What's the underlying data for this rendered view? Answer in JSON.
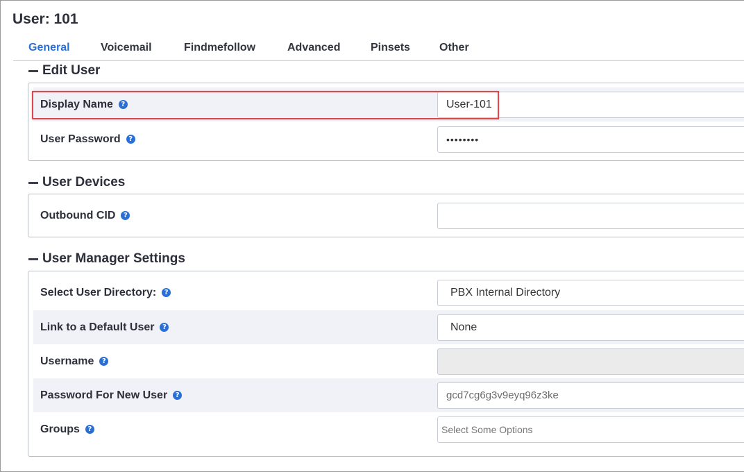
{
  "page": {
    "title": "User: 101"
  },
  "tabs": [
    {
      "label": "General",
      "active": true
    },
    {
      "label": "Voicemail"
    },
    {
      "label": "Findmefollow"
    },
    {
      "label": "Advanced"
    },
    {
      "label": "Pinsets"
    },
    {
      "label": "Other"
    }
  ],
  "sections": {
    "edit_user": {
      "title": "Edit User",
      "display_name": {
        "label": "Display Name",
        "value": "User-101"
      },
      "user_password": {
        "label": "User Password",
        "value": "••••••••"
      }
    },
    "user_devices": {
      "title": "User Devices",
      "outbound_cid": {
        "label": "Outbound CID",
        "value": ""
      }
    },
    "user_manager": {
      "title": "User Manager Settings",
      "directory": {
        "label": "Select User Directory:",
        "value": "PBX Internal Directory"
      },
      "default_user": {
        "label": "Link to a Default User",
        "value": "None"
      },
      "username": {
        "label": "Username",
        "value": ""
      },
      "new_password": {
        "label": "Password For New User",
        "value": "gcd7cg6g3v9eyq96z3ke"
      },
      "groups": {
        "label": "Groups",
        "placeholder": "Select Some Options"
      }
    }
  },
  "icons": {
    "help": "?",
    "collapse": "minus-icon"
  },
  "colors": {
    "accent": "#2a6fd6",
    "highlight": "#e0474c",
    "row_shade": "#f0f2f7"
  }
}
